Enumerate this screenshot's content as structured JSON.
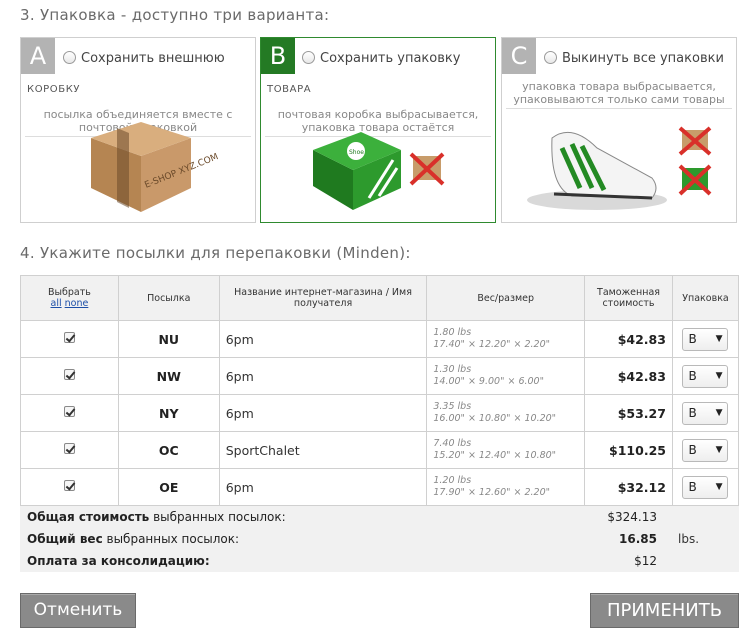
{
  "section3": {
    "title": "3. Упаковка - доступно три варианта:"
  },
  "options": [
    {
      "letter": "A",
      "label": "Сохранить внешнюю",
      "label2": "коробку",
      "desc": "посылка объединяется вместе с почтовой упаковкой",
      "box_text": "E-SHOP XYZ.COM"
    },
    {
      "letter": "B",
      "label": "Сохранить упаковку",
      "label2": "товара",
      "desc": "почтовая коробка выбрасывается, упаковка товара остаётся",
      "box_text": "Shoe"
    },
    {
      "letter": "C",
      "label": "Выкинуть все упаковки",
      "desc": "упаковка товара выбрасывается, упаковываются только сами товары"
    }
  ],
  "section4": {
    "title": "4. Укажите посылки для перепаковки (Minden):"
  },
  "table": {
    "headers": {
      "select": "Выбрать",
      "all": "all",
      "none": "none",
      "parcel": "Посылка",
      "shop": "Название интернет-магазина / Имя получателя",
      "weight": "Вес/размер",
      "customs": "Таможенная стоимость",
      "packing": "Упаковка"
    },
    "rows": [
      {
        "s": true,
        "code": "NU",
        "shop": "6pm",
        "wt": "1.80 lbs",
        "dim": "17.40\" × 12.20\" × 2.20\"",
        "cost": "$42.83",
        "pack": "B"
      },
      {
        "s": true,
        "code": "NW",
        "shop": "6pm",
        "wt": "1.30 lbs",
        "dim": "14.00\" × 9.00\" × 6.00\"",
        "cost": "$42.83",
        "pack": "B"
      },
      {
        "s": true,
        "code": "NY",
        "shop": "6pm",
        "wt": "3.35 lbs",
        "dim": "16.00\" × 10.80\" × 10.20\"",
        "cost": "$53.27",
        "pack": "B"
      },
      {
        "s": true,
        "code": "OC",
        "shop": "SportChalet",
        "wt": "7.40 lbs",
        "dim": "15.20\" × 12.40\" × 10.80\"",
        "cost": "$110.25",
        "pack": "B"
      },
      {
        "s": true,
        "code": "OE",
        "shop": "6pm",
        "wt": "1.20 lbs",
        "dim": "17.90\" × 12.60\" × 2.20\"",
        "cost": "$32.12",
        "pack": "B"
      }
    ]
  },
  "summary": {
    "total_cost_bold": "Общая стоимость",
    "total_cost_rest": " выбранных посылок:",
    "total_cost": "$324.13",
    "total_weight_bold": "Общий вес",
    "total_weight_rest": " выбранных посылок:",
    "total_weight": "16.85",
    "weight_unit": "lbs.",
    "consolidation_label": "Оплата за консолидацию:",
    "consolidation_fee": "$12"
  },
  "buttons": {
    "cancel": "Отменить",
    "apply": "ПРИМЕНИТЬ"
  },
  "colors": {
    "accent_green": "#247a24",
    "button_gray": "#8a8a8a"
  }
}
